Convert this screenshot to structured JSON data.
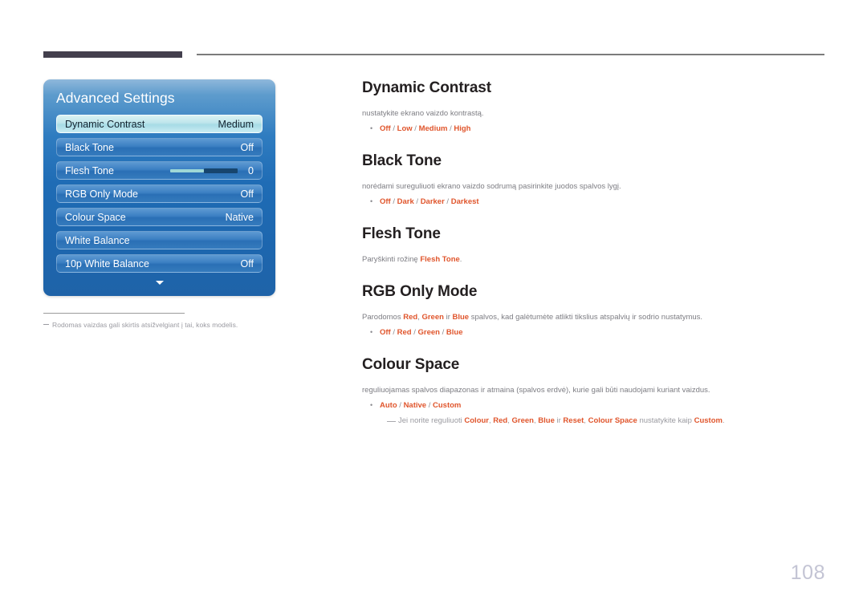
{
  "page": {
    "number": "108"
  },
  "osd": {
    "title": "Advanced Settings",
    "rows": [
      {
        "label": "Dynamic Contrast",
        "value": "Medium",
        "state": "selected",
        "type": "value"
      },
      {
        "label": "Black Tone",
        "value": "Off",
        "state": "normal",
        "type": "value"
      },
      {
        "label": "Flesh Tone",
        "value": "0",
        "state": "normal",
        "type": "slider"
      },
      {
        "label": "RGB Only Mode",
        "value": "Off",
        "state": "normal",
        "type": "value"
      },
      {
        "label": "Colour Space",
        "value": "Native",
        "state": "normal",
        "type": "value"
      },
      {
        "label": "White Balance",
        "value": "",
        "state": "normal",
        "type": "value"
      },
      {
        "label": "10p White Balance",
        "value": "Off",
        "state": "normal",
        "type": "value"
      }
    ],
    "scroll_icon": "chevron-down-icon",
    "footnote": "Rodomas vaizdas gali skirtis atsižvelgiant į tai, koks modelis."
  },
  "sections": [
    {
      "heading": "Dynamic Contrast",
      "desc_plain": "nustatykite ekrano vaizdo kontrastą.",
      "options": [
        "Off",
        "Low",
        "Medium",
        "High"
      ]
    },
    {
      "heading": "Black Tone",
      "desc_plain": "norėdami sureguliuoti ekrano vaizdo sodrumą pasirinkite juodos spalvos lygį.",
      "options": [
        "Off",
        "Dark",
        "Darker",
        "Darkest"
      ]
    },
    {
      "heading": "Flesh Tone",
      "desc_rich": [
        {
          "t": "Paryškinti rožinę ",
          "b": false
        },
        {
          "t": "Flesh Tone",
          "b": true
        },
        {
          "t": ".",
          "b": false
        }
      ],
      "options": []
    },
    {
      "heading": "RGB Only Mode",
      "desc_rich": [
        {
          "t": "Parodomos ",
          "b": false
        },
        {
          "t": "Red",
          "b": true
        },
        {
          "t": ", ",
          "b": false
        },
        {
          "t": "Green",
          "b": true
        },
        {
          "t": " ir ",
          "b": false
        },
        {
          "t": "Blue",
          "b": true
        },
        {
          "t": " spalvos, kad galėtumėte atlikti tikslius atspalvių ir sodrio nustatymus.",
          "b": false
        }
      ],
      "options": [
        "Off",
        "Red",
        "Green",
        "Blue"
      ]
    },
    {
      "heading": "Colour Space",
      "desc_plain": "reguliuojamas spalvos diapazonas ir atmaina (spalvos erdvė), kurie gali būti naudojami kuriant vaizdus.",
      "options": [
        "Auto",
        "Native",
        "Custom"
      ],
      "subnote": [
        {
          "t": "Jei norite reguliuoti ",
          "b": false
        },
        {
          "t": "Colour",
          "b": true
        },
        {
          "t": ", ",
          "b": false
        },
        {
          "t": "Red",
          "b": true
        },
        {
          "t": ", ",
          "b": false
        },
        {
          "t": "Green",
          "b": true
        },
        {
          "t": ", ",
          "b": false
        },
        {
          "t": "Blue",
          "b": true
        },
        {
          "t": " ir ",
          "b": false
        },
        {
          "t": "Reset",
          "b": true
        },
        {
          "t": ", ",
          "b": false
        },
        {
          "t": "Colour Space",
          "b": true
        },
        {
          "t": " nustatykite kaip ",
          "b": false
        },
        {
          "t": "Custom",
          "b": true
        },
        {
          "t": ".",
          "b": false
        }
      ]
    }
  ],
  "colors": {
    "accent": "#e0552c",
    "header_bar": "#433f4d",
    "panel_blue": "#1f6cb5",
    "page_number": "#c3c4d4"
  }
}
